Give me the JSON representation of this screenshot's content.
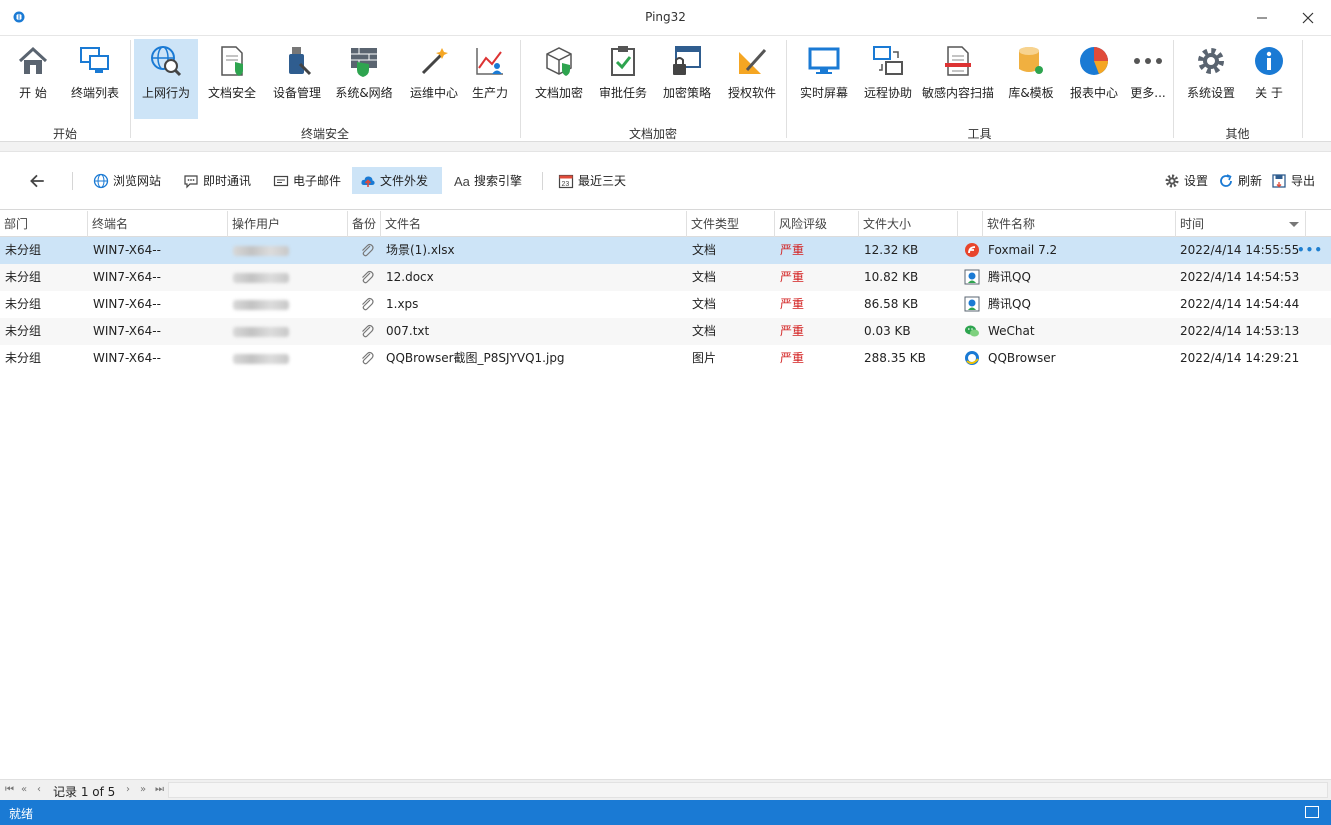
{
  "window": {
    "title": "Ping32"
  },
  "ribbon": {
    "buttons": [
      {
        "label": "开 始"
      },
      {
        "label": "终端列表"
      },
      {
        "label": "上网行为"
      },
      {
        "label": "文档安全"
      },
      {
        "label": "设备管理"
      },
      {
        "label": "系统&网络"
      },
      {
        "label": "运维中心"
      },
      {
        "label": "生产力"
      },
      {
        "label": "文档加密"
      },
      {
        "label": "审批任务"
      },
      {
        "label": "加密策略"
      },
      {
        "label": "授权软件"
      },
      {
        "label": "实时屏幕"
      },
      {
        "label": "远程协助"
      },
      {
        "label": "敏感内容扫描"
      },
      {
        "label": "库&模板"
      },
      {
        "label": "报表中心"
      },
      {
        "label": "更多..."
      },
      {
        "label": "系统设置"
      },
      {
        "label": "关 于"
      }
    ],
    "groups": [
      "开始",
      "终端安全",
      "文档加密",
      "工具",
      "其他"
    ]
  },
  "toolbar": {
    "tabs": [
      "浏览网站",
      "即时通讯",
      "电子邮件",
      "文件外发",
      "搜索引擎"
    ],
    "range": "最近三天",
    "settings": "设置",
    "refresh": "刷新",
    "export": "导出"
  },
  "table": {
    "columns": [
      "部门",
      "终端名",
      "操作用户",
      "备份",
      "文件名",
      "文件类型",
      "风险评级",
      "文件大小",
      "",
      "软件名称",
      "时间"
    ],
    "rows": [
      {
        "dept": "未分组",
        "terminal": "WIN7-X64--",
        "file": "场景(1).xlsx",
        "type": "文档",
        "risk": "严重",
        "size": "12.32 KB",
        "software": "Foxmail 7.2",
        "time": "2022/4/14 14:55:55"
      },
      {
        "dept": "未分组",
        "terminal": "WIN7-X64--",
        "file": "12.docx",
        "type": "文档",
        "risk": "严重",
        "size": "10.82 KB",
        "software": "腾讯QQ",
        "time": "2022/4/14 14:54:53"
      },
      {
        "dept": "未分组",
        "terminal": "WIN7-X64--",
        "file": "1.xps",
        "type": "文档",
        "risk": "严重",
        "size": "86.58 KB",
        "software": "腾讯QQ",
        "time": "2022/4/14 14:54:44"
      },
      {
        "dept": "未分组",
        "terminal": "WIN7-X64--",
        "file": "007.txt",
        "type": "文档",
        "risk": "严重",
        "size": "0.03 KB",
        "software": "WeChat",
        "time": "2022/4/14 14:53:13"
      },
      {
        "dept": "未分组",
        "terminal": "WIN7-X64--",
        "file": "QQBrowser截图_P8SJYVQ1.jpg",
        "type": "图片",
        "risk": "严重",
        "size": "288.35 KB",
        "software": "QQBrowser",
        "time": "2022/4/14 14:29:21"
      }
    ],
    "more": "•••"
  },
  "pager": {
    "record": "记录 1 of 5"
  },
  "status": {
    "text": "就绪"
  },
  "colors": {
    "accent": "#1a7ad4",
    "selection": "#cde4f7",
    "risk": "#d32020"
  }
}
